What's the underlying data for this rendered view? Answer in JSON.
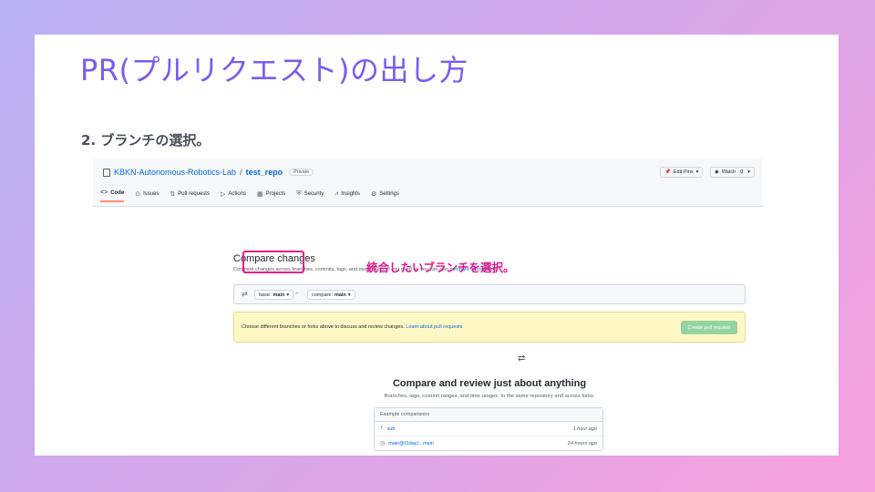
{
  "slide": {
    "title": "PR(プルリクエスト)の出し方",
    "step": "2. ブランチの選択。",
    "annotation": "統合したいブランチを選択。"
  },
  "repo": {
    "owner": "KBKN-Autonomous-Robotics-Lab",
    "separator": "/",
    "name": "test_repo",
    "visibility": "Private",
    "edit_pins_label": "Edit Pins",
    "watch_label": "Watch",
    "watch_count": "0"
  },
  "tabs": [
    {
      "label": "Code",
      "icon": "code-icon"
    },
    {
      "label": "Issues",
      "icon": "issue-icon"
    },
    {
      "label": "Pull requests",
      "icon": "pull-request-icon"
    },
    {
      "label": "Actions",
      "icon": "play-icon"
    },
    {
      "label": "Projects",
      "icon": "table-icon"
    },
    {
      "label": "Security",
      "icon": "shield-icon"
    },
    {
      "label": "Insights",
      "icon": "graph-icon"
    },
    {
      "label": "Settings",
      "icon": "gear-icon"
    }
  ],
  "compare": {
    "title": "Compare changes",
    "desc": "Compare changes across branches, commits, tags, and more below. If you need to, you can also",
    "desc_link": "compare across forks",
    "base_label": "base:",
    "base_value": "main",
    "compare_label": "compare:",
    "compare_value": "main"
  },
  "flash": {
    "text": "Choose different branches or forks above to discuss and review changes.",
    "link": "Learn about pull requests",
    "button": "Create pull request"
  },
  "review": {
    "title": "Compare and review just about anything",
    "subtitle": "Branches, tags, commit ranges, and time ranges. In the same repository and across forks."
  },
  "examples": {
    "header": "Example comparisons",
    "rows": [
      {
        "label": "sub",
        "time": "1 hour ago",
        "icon": "branch-icon"
      },
      {
        "label": "main@{1day}...main",
        "time": "24 hours ago",
        "icon": "clock-icon"
      }
    ]
  },
  "colors": {
    "title": "#7a5cf0",
    "annotation": "#e0198a",
    "link": "#0969da",
    "create_button": "#94d3a2"
  }
}
